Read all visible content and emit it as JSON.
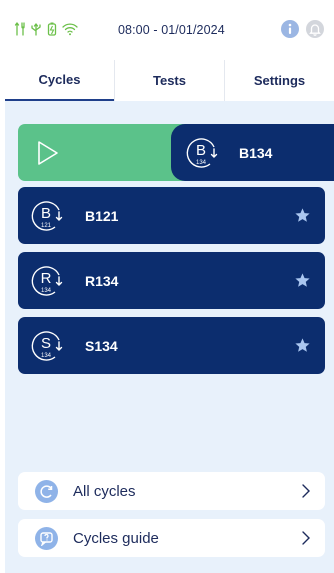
{
  "status_bar": {
    "icons": [
      "tools-icon",
      "usb-icon",
      "battery-icon",
      "wifi-icon"
    ],
    "time": "08:00 - 01/01/2024",
    "accent_green": "#6cc04a"
  },
  "tabs": [
    {
      "label": "Cycles",
      "active": true
    },
    {
      "label": "Tests",
      "active": false
    },
    {
      "label": "Settings",
      "active": false
    }
  ],
  "selected_cycle": {
    "badge_letter": "B",
    "badge_number": "134",
    "name": "B134",
    "start_color": "#5bc28a"
  },
  "favorites": [
    {
      "badge_letter": "B",
      "badge_number": "121",
      "name": "B121"
    },
    {
      "badge_letter": "R",
      "badge_number": "134",
      "name": "R134"
    },
    {
      "badge_letter": "S",
      "badge_number": "134",
      "name": "S134"
    }
  ],
  "links": {
    "all_cycles": "All cycles",
    "cycles_guide": "Cycles guide"
  },
  "colors": {
    "navy": "#0c2d6e",
    "panel": "#e8f1fb",
    "text": "#1d2b5c"
  }
}
